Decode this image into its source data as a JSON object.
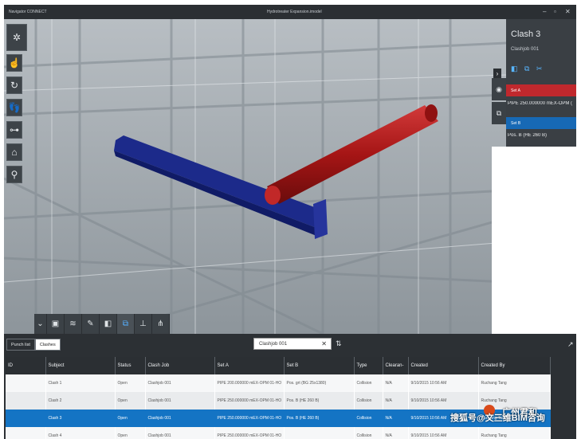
{
  "window": {
    "app_title": "Navigator CONNECT",
    "doc_title": "Hydrotreater Expansion.imodel",
    "controls": [
      "–",
      "▫",
      "✕"
    ]
  },
  "left_tools": [
    {
      "name": "navigation-cube-icon",
      "glyph": "✲"
    },
    {
      "name": "select-tool-icon",
      "glyph": "☝"
    },
    {
      "name": "rotate-tool-icon",
      "glyph": "↻"
    },
    {
      "name": "walk-tool-icon",
      "glyph": "👣"
    },
    {
      "name": "measure-tool-icon",
      "glyph": "⊶"
    },
    {
      "name": "home-view-icon",
      "glyph": "⌂"
    },
    {
      "name": "zoom-tool-icon",
      "glyph": "⚲"
    }
  ],
  "bottom_tools": [
    {
      "name": "collapse-icon",
      "glyph": "⌄"
    },
    {
      "name": "view-icon",
      "glyph": "▣"
    },
    {
      "name": "layers-icon",
      "glyph": "≋"
    },
    {
      "name": "markup-icon",
      "glyph": "✎"
    },
    {
      "name": "section-icon",
      "glyph": "◧"
    },
    {
      "name": "clash-icon",
      "glyph": "⧉"
    },
    {
      "name": "tree-icon",
      "glyph": "⊥"
    },
    {
      "name": "hierarchy-icon",
      "glyph": "⋔"
    }
  ],
  "side_panel": {
    "title": "Clash 3",
    "subtitle": "Clashjob 001",
    "toggle_icons": "◧ ⧉ ✂",
    "set_a_label": "Set A",
    "set_a_value": "PIPE 250.000000 mEX-OPM (",
    "set_b_label": "Set B",
    "set_b_value": "Pos. B (HE 260 B)",
    "expand_glyph": "›"
  },
  "lower": {
    "tabs": [
      "Punch list",
      "Clashes"
    ],
    "active_tab": "Clashes",
    "search_value": "Clashjob 001",
    "clear_glyph": "✕",
    "sort_glyph": "⇅",
    "export_glyph": "↗"
  },
  "table": {
    "columns": [
      "ID",
      "Subject",
      "Status",
      "Clash Job",
      "Set A",
      "Set B",
      "Type",
      "Clearan-",
      "Created",
      "Created By"
    ],
    "rows": [
      [
        "",
        "Clash 1",
        "Open",
        "Clashjob 001",
        "PIPE 200.000000 mEX-OPM 01-HO",
        "Pos. grt (BG 25x1380)",
        "Collision",
        "N/A",
        "9/10/2015 10:56 AM",
        "Ruchang Tang"
      ],
      [
        "",
        "Clash 2",
        "Open",
        "Clashjob 001",
        "PIPE 250.000000 mEX-OPM 01-HO",
        "Pos. B (HE 260 B)",
        "Collision",
        "N/A",
        "9/10/2015 10:56 AM",
        "Ruchang Tang"
      ],
      [
        "",
        "Clash 3",
        "Open",
        "Clashjob 001",
        "PIPE 250.000000 mEX-OPM 01-HO",
        "Pos. B (HE 260 B)",
        "Collision",
        "N/A",
        "9/10/2015 10:56 AM",
        "Ruchang Tang"
      ],
      [
        "",
        "Clash 4",
        "Open",
        "Clashjob 001",
        "PIPE 250.000000 mEX-OPM 01-HO",
        "",
        "Collision",
        "N/A",
        "9/10/2015 10:56 AM",
        "Ruchang Tang"
      ]
    ],
    "selected_row": 2
  },
  "watermark": {
    "line1": "广州君和",
    "line2": "搜狐号@文三维BIM咨询"
  },
  "colors": {
    "accent_blue": "#1474c4",
    "clash_red": "#c0282d",
    "beam_blue": "#1c2a8a",
    "pipe_red": "#b01c1c"
  }
}
